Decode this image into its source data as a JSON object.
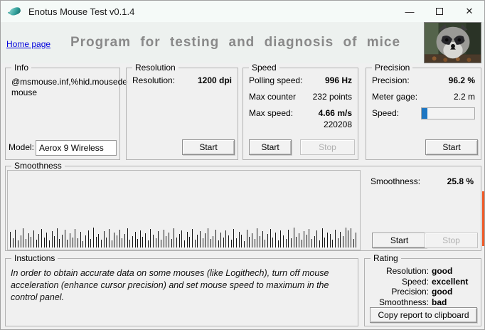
{
  "window": {
    "title": "Enotus Mouse Test v0.1.4",
    "minimize_glyph": "—",
    "close_glyph": "✕"
  },
  "header": {
    "home_link": "Home page",
    "heading": "Program for testing and diagnosis of mice"
  },
  "info": {
    "label": "Info",
    "device_info_line1": "@msmouse.inf,%hid.mousede",
    "device_info_line2": "mouse",
    "model_label": "Model:",
    "model_value": "Aerox 9 Wireless"
  },
  "resolution": {
    "label": "Resolution",
    "row_label": "Resolution:",
    "row_value": "1200 dpi",
    "start_label": "Start"
  },
  "speed": {
    "label": "Speed",
    "polling_label": "Polling speed:",
    "polling_value": "996 Hz",
    "counter_label": "Max counter",
    "counter_value": "232 points",
    "maxspeed_label": "Max  speed:",
    "maxspeed_value": "4.66 m/s",
    "extra_value": "220208",
    "start_label": "Start",
    "stop_label": "Stop"
  },
  "precision": {
    "label": "Precision",
    "precision_label": "Precision:",
    "precision_value": "96.2 %",
    "gage_label": "Meter gage:",
    "gage_value": "2.2 m",
    "speed_label": "Speed:",
    "speed_gauge_percent": 11,
    "start_label": "Start"
  },
  "smoothness": {
    "label": "Smoothness",
    "value_label": "Smoothness:",
    "value": "25.8 %",
    "start_label": "Start",
    "stop_label": "Stop",
    "bars": [
      22,
      13,
      25,
      10,
      17,
      27,
      12,
      20,
      15,
      24,
      11,
      19,
      26,
      14,
      21,
      10,
      23,
      16,
      27,
      12,
      18,
      25,
      11,
      20,
      14,
      26,
      13,
      22,
      9,
      17,
      24,
      12,
      28,
      15,
      19,
      11,
      23,
      14,
      26,
      10,
      21,
      17,
      25,
      13,
      19,
      27,
      11,
      16,
      22,
      12,
      24,
      15,
      20,
      10,
      26,
      18,
      13,
      23,
      11,
      25,
      16,
      21,
      12,
      27,
      14,
      19,
      24,
      10,
      22,
      15,
      26,
      11,
      18,
      23,
      13,
      20,
      27,
      12,
      16,
      25,
      10,
      21,
      14,
      24,
      17,
      11,
      26,
      13,
      22,
      18,
      9,
      25,
      15,
      20,
      12,
      27,
      16,
      23,
      11,
      19,
      26,
      14,
      21,
      10,
      24,
      17,
      12,
      25,
      13,
      28,
      15,
      20,
      11,
      23,
      18,
      26,
      12,
      16,
      24,
      10,
      27,
      14,
      21,
      19,
      11,
      25,
      13,
      22,
      16,
      28,
      24,
      27,
      12,
      21
    ]
  },
  "instructions": {
    "label": "Instuctions",
    "text": "In order to obtain accurate data on some mouses (like Logithech), turn off mouse acceleration (enhance cursor precision) and set mouse speed to maximum in the control panel."
  },
  "rating": {
    "label": "Rating",
    "rows": [
      {
        "label": "Resolution:",
        "value": "good"
      },
      {
        "label": "Speed:",
        "value": "excellent"
      },
      {
        "label": "Precision:",
        "value": "good"
      },
      {
        "label": "Smoothness:",
        "value": "bad"
      }
    ],
    "copy_button": "Copy report to clipboard"
  },
  "colors": {
    "progress_fill": "#1d76c2",
    "heading_text": "#898989",
    "link": "#0000dd",
    "edge_marker": "#f05a28"
  }
}
